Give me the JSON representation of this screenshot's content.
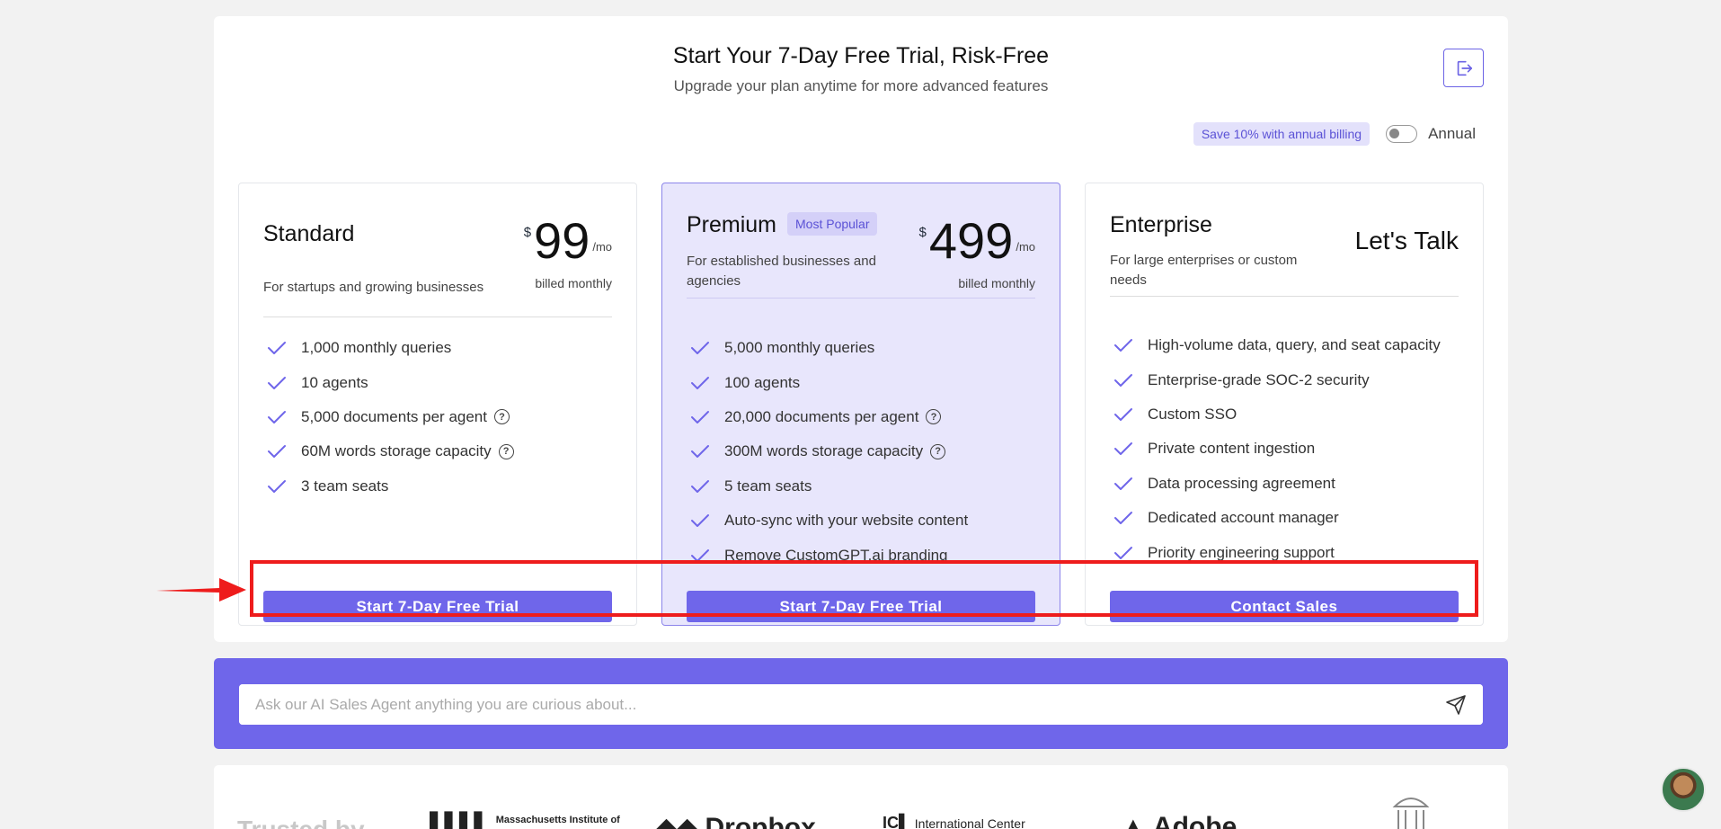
{
  "header": {
    "title": "Start Your 7-Day Free Trial, Risk-Free",
    "subtitle": "Upgrade your plan anytime for more advanced features"
  },
  "billing": {
    "save_badge": "Save 10% with annual billing",
    "toggle_label": "Annual",
    "annual_enabled": false
  },
  "plans": [
    {
      "name": "Standard",
      "description": "For startups and growing businesses",
      "currency": "$",
      "price": "99",
      "per": "/mo",
      "billed": "billed monthly",
      "features": [
        {
          "text": "1,000 monthly queries",
          "help": false
        },
        {
          "text": "10 agents",
          "help": false
        },
        {
          "text": "5,000 documents per agent",
          "help": true
        },
        {
          "text": "60M words storage capacity",
          "help": true
        },
        {
          "text": "3 team seats",
          "help": false
        }
      ],
      "cta": "Start 7-Day Free Trial"
    },
    {
      "name": "Premium",
      "badge": "Most Popular",
      "description": "For established businesses and agencies",
      "currency": "$",
      "price": "499",
      "per": "/mo",
      "billed": "billed monthly",
      "features": [
        {
          "text": "5,000 monthly queries",
          "help": false
        },
        {
          "text": "100 agents",
          "help": false
        },
        {
          "text": "20,000 documents per agent",
          "help": true
        },
        {
          "text": "300M words storage capacity",
          "help": true
        },
        {
          "text": "5 team seats",
          "help": false
        },
        {
          "text": "Auto-sync with your website content",
          "help": false
        },
        {
          "text": "Remove CustomGPT.ai branding",
          "help": false
        }
      ],
      "cta": "Start 7-Day Free Trial"
    },
    {
      "name": "Enterprise",
      "description": "For large enterprises or custom needs",
      "price_text": "Let's Talk",
      "features": [
        {
          "text": "High-volume data, query, and seat capacity",
          "help": false
        },
        {
          "text": "Enterprise-grade SOC-2 security",
          "help": false
        },
        {
          "text": "Custom SSO",
          "help": false
        },
        {
          "text": "Private content ingestion",
          "help": false
        },
        {
          "text": "Data processing agreement",
          "help": false
        },
        {
          "text": "Dedicated account manager",
          "help": false
        },
        {
          "text": "Priority engineering support",
          "help": false
        }
      ],
      "cta": "Contact Sales"
    }
  ],
  "chat": {
    "placeholder": "Ask our AI Sales Agent anything you are curious about..."
  },
  "trusted": {
    "label": "Trusted by",
    "logos": [
      "Massachusetts Institute of",
      "Dropbox",
      "International Center",
      "Adobe"
    ]
  },
  "colors": {
    "accent": "#6f66ea",
    "highlight": "#ee1c1c",
    "premium_bg": "#e8e6fc"
  }
}
